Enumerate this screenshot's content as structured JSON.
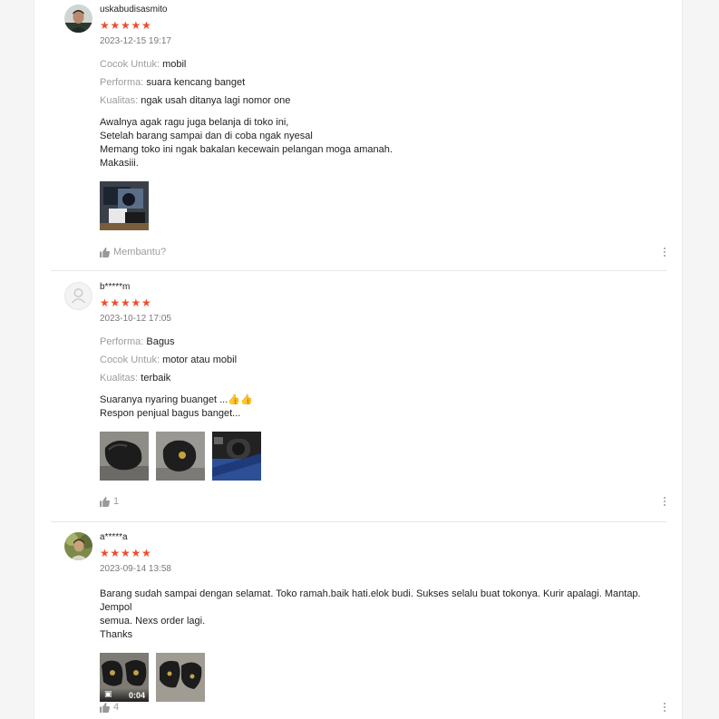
{
  "reviews": [
    {
      "author": "uskabudisasmito",
      "stars": 5,
      "time": "2023-12-15 19:17",
      "attributes": [
        {
          "key": "Cocok Untuk:",
          "value": "mobil"
        },
        {
          "key": "Performa:",
          "value": "suara kencang banget"
        },
        {
          "key": "Kualitas:",
          "value": "ngak usah ditanya lagi nomor one"
        }
      ],
      "text": "Awalnya agak ragu juga belanja di toko ini,\nSetelah barang sampai dan di coba ngak nyesal\nMemang toko ini ngak bakalan kecewain pelangan moga amanah.\nMakasiii.",
      "helpful_label": "Membantu?"
    },
    {
      "author": "b*****m",
      "stars": 5,
      "time": "2023-10-12 17:05",
      "attributes": [
        {
          "key": "Performa:",
          "value": "Bagus"
        },
        {
          "key": "Cocok Untuk:",
          "value": "motor atau mobil"
        },
        {
          "key": "Kualitas:",
          "value": "terbaik"
        }
      ],
      "text": "Suaranya nyaring buanget ...👍👍\nRespon penjual bagus banget...",
      "helpful_label": "1"
    },
    {
      "author": "a*****a",
      "stars": 5,
      "time": "2023-09-14 13:58",
      "attributes": [],
      "text": "Barang sudah sampai dengan selamat. Toko ramah.baik hati.elok budi. Sukses selalu buat tokonya. Kurir apalagi. Mantap. Jempol\nsemua. Nexs order lagi.\nThanks",
      "video_duration": "0:04",
      "helpful_label": "4"
    }
  ],
  "colors": {
    "star": "#ee4d2d",
    "muted": "rgba(0,0,0,.4)"
  },
  "icons": [
    "thumbs-up-icon",
    "more-vertical-icon",
    "video-camera-icon",
    "default-avatar-icon"
  ]
}
